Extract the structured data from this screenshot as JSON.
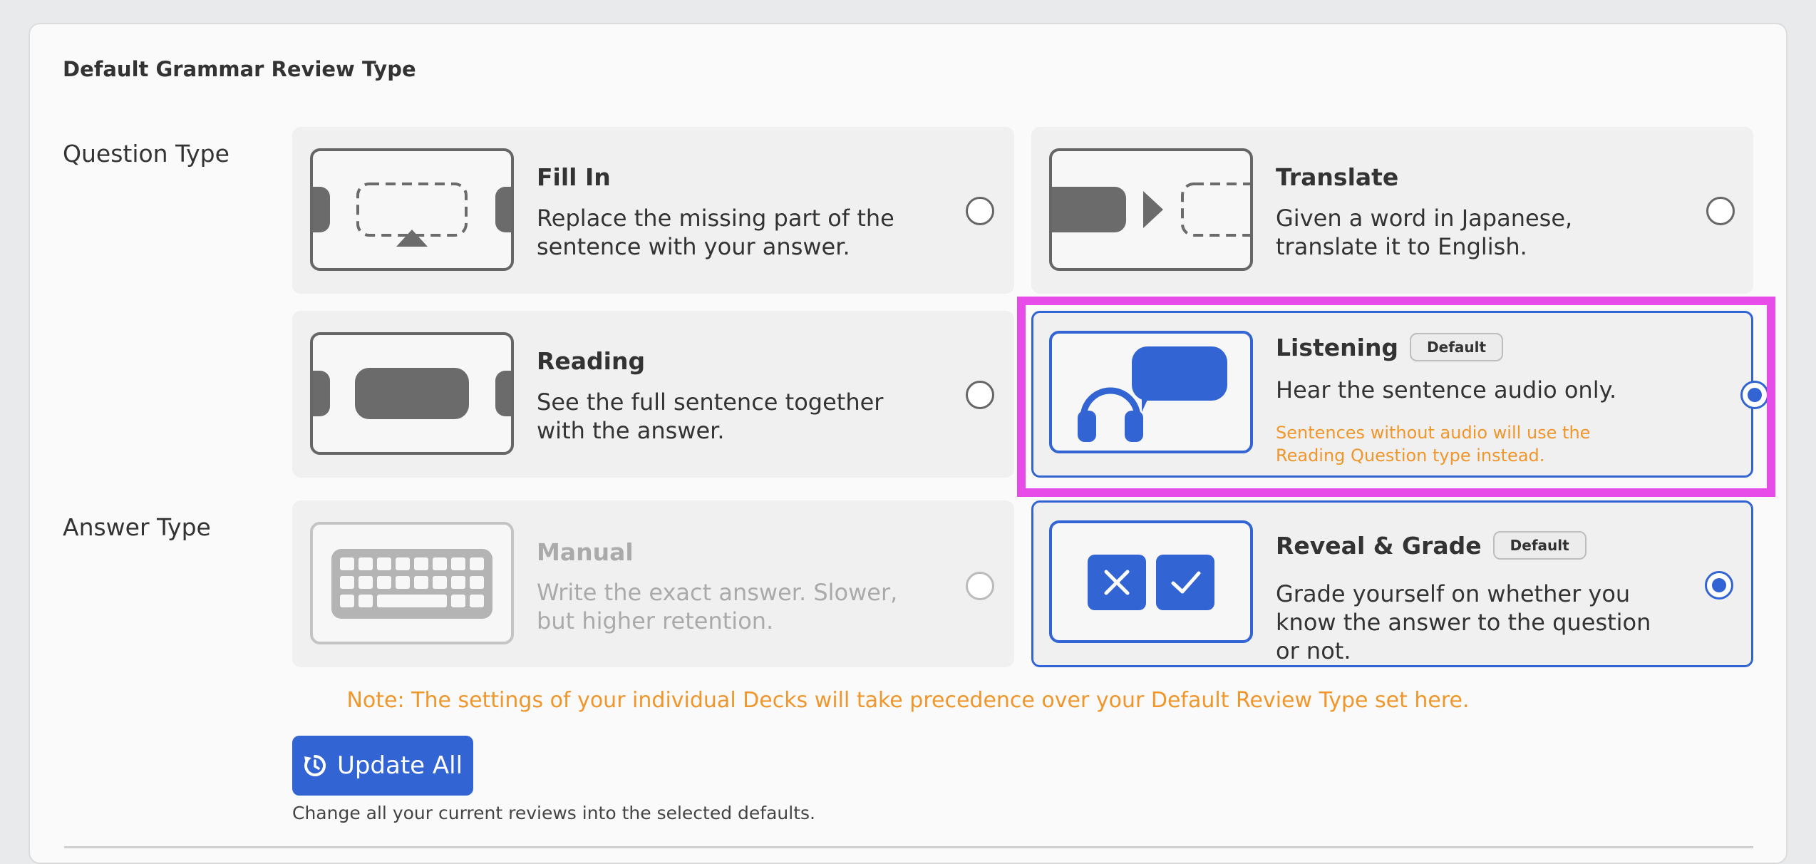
{
  "section_title": "Default Grammar Review Type",
  "question_type_label": "Question Type",
  "answer_type_label": "Answer Type",
  "cards": {
    "fill_in": {
      "title": "Fill In",
      "desc": "Replace the missing part of the sentence with your answer."
    },
    "translate": {
      "title": "Translate",
      "desc": "Given a word in Japanese, translate it to English."
    },
    "reading": {
      "title": "Reading",
      "desc": "See the full sentence together with the answer."
    },
    "listening": {
      "title": "Listening",
      "badge": "Default",
      "desc": "Hear the sentence audio only.",
      "warning": "Sentences without audio will use the Reading Question type instead."
    },
    "manual": {
      "title": "Manual",
      "desc": "Write the exact answer. Slower, but higher retention."
    },
    "reveal_grade": {
      "title": "Reveal & Grade",
      "badge": "Default",
      "desc": "Grade yourself on whether you know the answer to the question or not."
    }
  },
  "selected": {
    "question_type": "Listening",
    "answer_type": "Reveal & Grade"
  },
  "note": "Note: The settings of your individual Decks will take precedence over your Default Review Type set here.",
  "update_button": {
    "label": "Update All",
    "icon": "refresh-clock-icon"
  },
  "helper_text": "Change all your current reviews into the selected defaults.",
  "colors": {
    "accent": "#3264d3",
    "warning": "#f0962a",
    "highlight": "#e84ce8",
    "icon_gray": "#6b6b6b"
  }
}
